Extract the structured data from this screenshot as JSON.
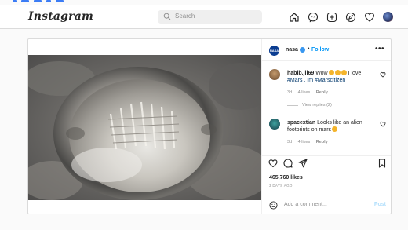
{
  "header": {
    "logo": "Instagram",
    "search_placeholder": "Search",
    "nav_icons": [
      "home-icon",
      "messenger-icon",
      "new-post-icon",
      "explore-icon",
      "activity-heart-icon",
      "profile-avatar"
    ]
  },
  "post": {
    "author": "nasa",
    "dot": "•",
    "follow_label": "Follow",
    "more": "•••",
    "comments": [
      {
        "user": "habib.jli69",
        "text": "Wow",
        "text_end": " I love",
        "tags": "#Mars , Im #Marscitizen",
        "age": "3d",
        "likes": "4 likes",
        "reply": "Reply",
        "view_replies": "View replies (2)"
      },
      {
        "user": "spacextian",
        "text": "Looks like an alien footprints on mars",
        "age": "3d",
        "likes": "4 likes",
        "reply": "Reply"
      }
    ],
    "likes_count": "465,760 likes",
    "time_ago": "3 DAYS AGO",
    "add_comment_placeholder": "Add a comment...",
    "post_button": "Post"
  },
  "colors": {
    "accent": "#0095f6",
    "link": "#00376b",
    "border": "#dbdbdb",
    "muted": "#8e8e8e"
  }
}
